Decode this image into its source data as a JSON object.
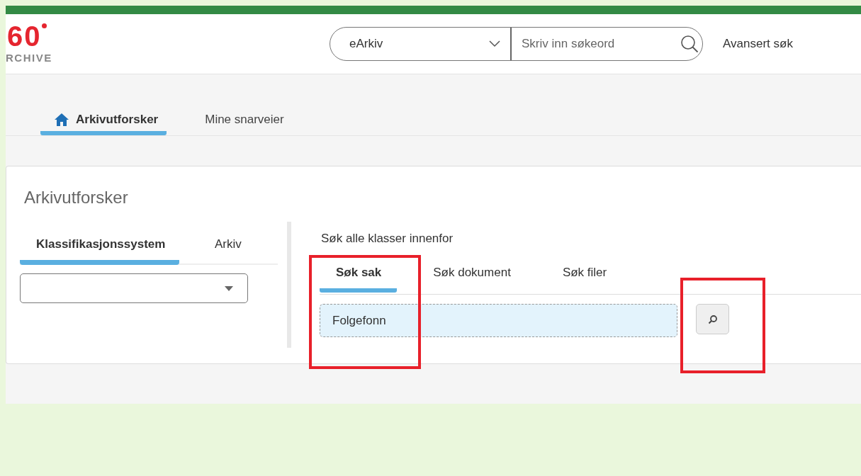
{
  "logo": {
    "number": "60",
    "word": "RCHIVE"
  },
  "header": {
    "scope_select": {
      "value": "eArkiv"
    },
    "search": {
      "placeholder": "Skriv inn søkeord"
    },
    "advanced_link": "Avansert søk"
  },
  "nav_tabs": [
    {
      "label": "Arkivutforsker",
      "selected": true,
      "kind": "home"
    },
    {
      "label": "Mine snarveier",
      "selected": false,
      "kind": "plain"
    }
  ],
  "card": {
    "title": "Arkivutforsker",
    "left_tabs": [
      {
        "label": "Klassifikasjonssystem",
        "selected": true
      },
      {
        "label": "Arkiv",
        "selected": false
      }
    ],
    "right": {
      "caption": "Søk alle klasser innenfor",
      "tabs": [
        {
          "label": "Søk sak",
          "selected": true,
          "highlighted": true
        },
        {
          "label": "Søk dokument",
          "selected": false,
          "highlighted": false
        },
        {
          "label": "Søk filer",
          "selected": false,
          "highlighted": false
        }
      ],
      "query": {
        "value": "Folgefonn"
      },
      "search_button": {
        "highlighted": true
      }
    }
  }
}
